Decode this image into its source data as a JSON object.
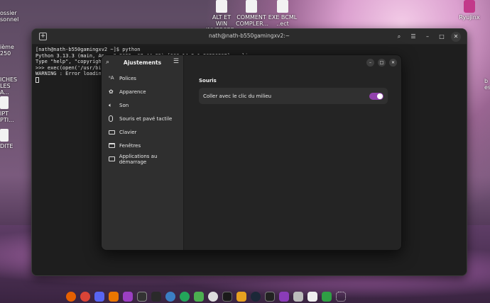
{
  "desktop": {
    "icons": [
      {
        "name": "icon-alt-et-win",
        "label": "ALT ET WIN INVERSEE..."
      },
      {
        "name": "icon-comment",
        "label": "COMMENT COMPLER..."
      },
      {
        "name": "icon-exe",
        "label": "EXE BCML ..ect"
      },
      {
        "name": "icon-ryujinx",
        "label": "Ryujinx"
      },
      {
        "name": "icon-left-1",
        "label": "ossier sonnel"
      },
      {
        "name": "icon-left-2",
        "label": "ième 250"
      },
      {
        "name": "icon-left-3",
        "label": "ICHES LES A..."
      },
      {
        "name": "icon-left-4",
        "label": "IPT PTI..."
      },
      {
        "name": "icon-left-5",
        "label": "DITE"
      },
      {
        "name": "icon-right-1",
        "label": "b es"
      }
    ]
  },
  "terminal": {
    "title": "nath@nath-b550gamingxv2:~",
    "lines": [
      "[nath@nath-b550gamingxv2 ~]$ python",
      "Python 3.13.3 (main, Apr  9 2025, 07:44:25) [GCC 14.2.1 20250207] on linux",
      "Type \"help\", \"copyright\"",
      ">>> exec(open('/usr/bin/",
      "WARNING : Error loading"
    ]
  },
  "settings": {
    "title": "Ajustements",
    "nav": [
      {
        "label": "Polices",
        "icon": "font-icon"
      },
      {
        "label": "Apparence",
        "icon": "appearance-icon"
      },
      {
        "label": "Son",
        "icon": "sound-icon"
      },
      {
        "label": "Souris et pavé tactile",
        "icon": "mouse-icon"
      },
      {
        "label": "Clavier",
        "icon": "keyboard-icon"
      },
      {
        "label": "Fenêtres",
        "icon": "window-icon"
      },
      {
        "label": "Applications au démarrage",
        "icon": "folder-icon"
      }
    ],
    "section_title": "Souris",
    "row_label": "Coller avec le clic du milieu",
    "toggle_on": true,
    "accent": "#9141ac"
  },
  "dock": {
    "icons": [
      "firefox-icon",
      "chrome-icon",
      "discord-icon",
      "blender-icon",
      "vscode-icon",
      "steam-icon",
      "settings-icon",
      "terminal-icon",
      "files-icon"
    ]
  }
}
